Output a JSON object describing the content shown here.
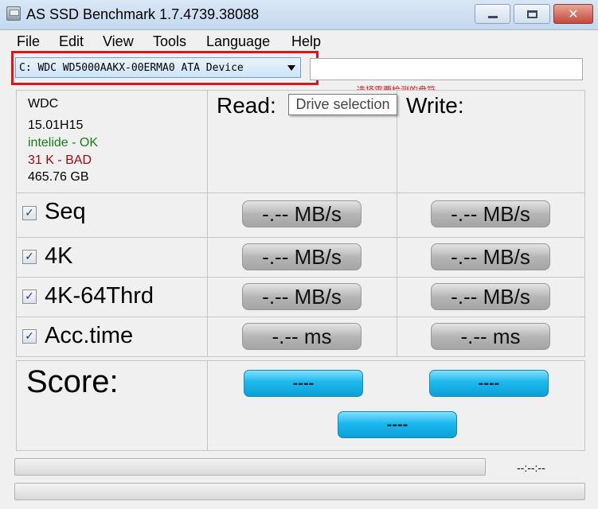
{
  "window": {
    "title": "AS SSD Benchmark 1.7.4739.38088",
    "close_glyph": "✕"
  },
  "menu": [
    "File",
    "Edit",
    "View",
    "Tools",
    "Language",
    "Help"
  ],
  "drive": {
    "selected": "C: WDC WD5000AAKX-00ERMA0 ATA Device",
    "annotation": "选择需要检测的盘符",
    "tooltip": "Drive selection",
    "path_value": ""
  },
  "info": {
    "name": "WDC",
    "firmware": "15.01H15",
    "driver_status": "intelide - OK",
    "alignment_status": "31 K - BAD",
    "capacity": "465.76 GB",
    "ok_color": "#1a7a1a",
    "bad_color": "#9b0a0a"
  },
  "headers": {
    "read": "Read:",
    "write": "Write:"
  },
  "tests": [
    {
      "label": "Seq",
      "checked": true,
      "read": "-.-- MB/s",
      "write": "-.-- MB/s"
    },
    {
      "label": "4K",
      "checked": true,
      "read": "-.-- MB/s",
      "write": "-.-- MB/s"
    },
    {
      "label": "4K-64Thrd",
      "checked": true,
      "read": "-.-- MB/s",
      "write": "-.-- MB/s"
    },
    {
      "label": "Acc.time",
      "checked": true,
      "read": "-.-- ms",
      "write": "-.-- ms"
    }
  ],
  "check_glyph": "✓",
  "score": {
    "label": "Score:",
    "read": "----",
    "write": "----",
    "total": "----"
  },
  "progress": {
    "time": "--:--:--",
    "value_1": 0,
    "value_2": 0
  },
  "colors": {
    "annotation_red": "#e0141b",
    "score_blue": "#1cb8ee"
  }
}
